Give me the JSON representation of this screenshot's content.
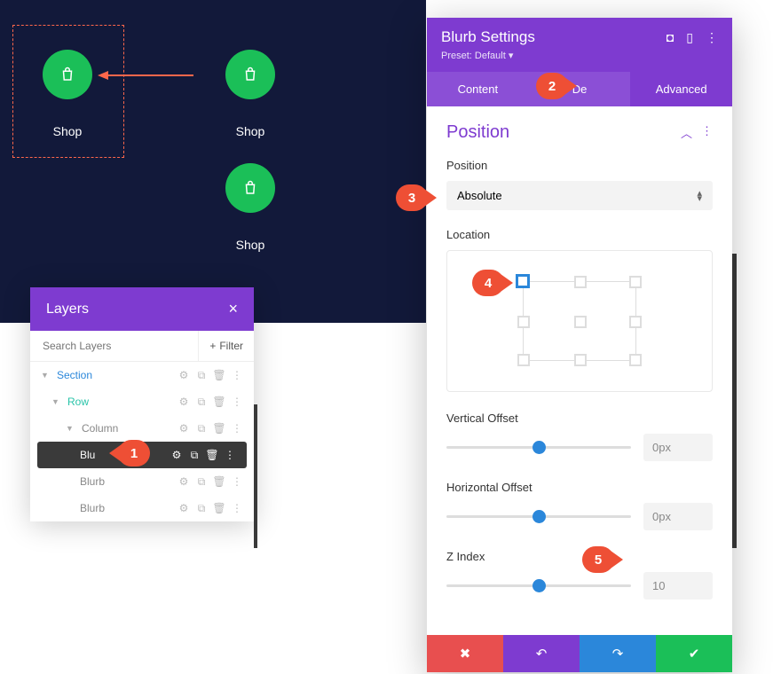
{
  "preview": {
    "items": [
      {
        "label": "Shop"
      },
      {
        "label": "Shop"
      },
      {
        "label": "Shop"
      }
    ]
  },
  "layers": {
    "title": "Layers",
    "search_placeholder": "Search Layers",
    "filter_label": "Filter",
    "rows": [
      {
        "name": "Section"
      },
      {
        "name": "Row"
      },
      {
        "name": "Column"
      },
      {
        "name": "Blu"
      },
      {
        "name": "Blurb"
      },
      {
        "name": "Blurb"
      }
    ]
  },
  "settings": {
    "title": "Blurb Settings",
    "preset": "Preset: Default",
    "tabs": {
      "content": "Content",
      "design": "De",
      "advanced": "Advanced"
    },
    "position": {
      "section_title": "Position",
      "position_label": "Position",
      "position_value": "Absolute",
      "location_label": "Location",
      "vertical_label": "Vertical Offset",
      "vertical_value": "0px",
      "horizontal_label": "Horizontal Offset",
      "horizontal_value": "0px",
      "zindex_label": "Z Index",
      "zindex_value": "10"
    }
  },
  "callouts": {
    "c1": "1",
    "c2": "2",
    "c3": "3",
    "c4": "4",
    "c5": "5"
  }
}
